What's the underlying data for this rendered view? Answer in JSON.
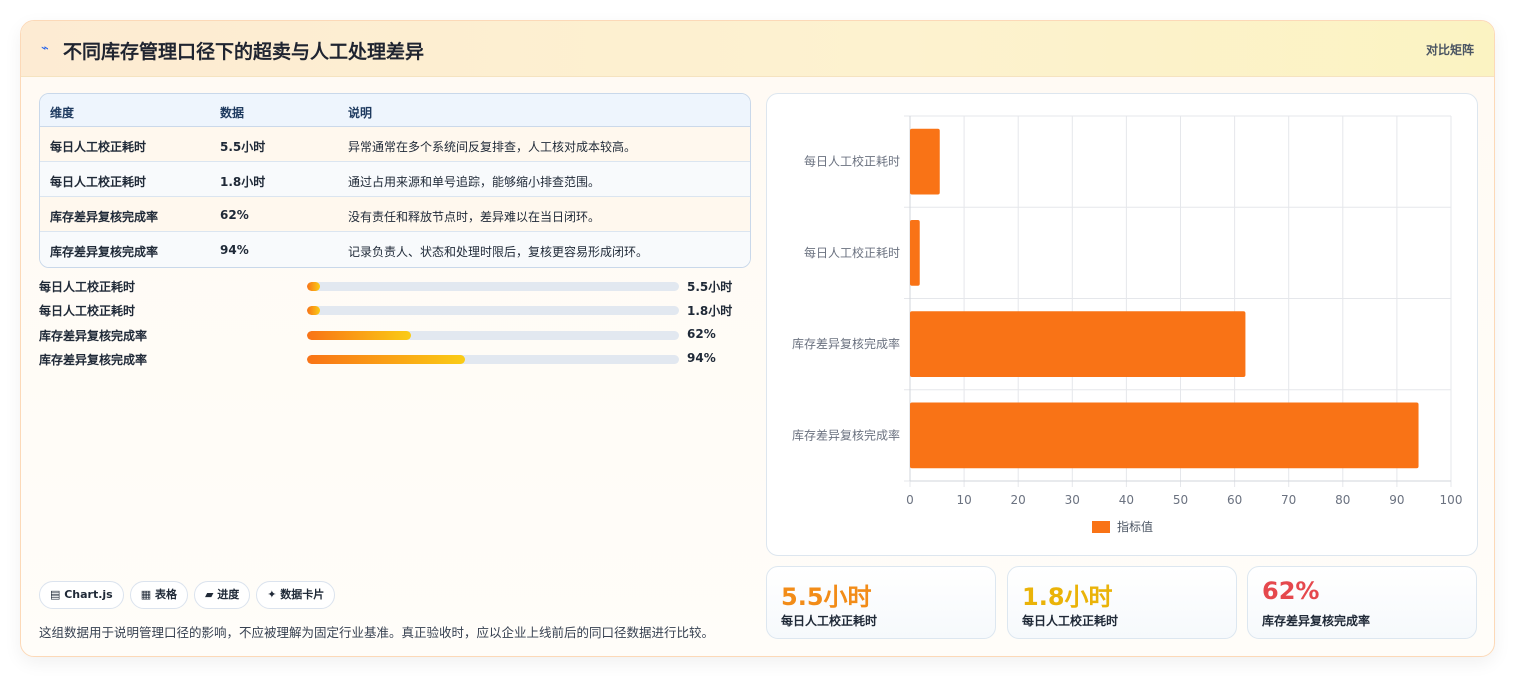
{
  "header": {
    "title": "不同库存管理口径下的超卖与人工处理差异",
    "tag": "对比矩阵"
  },
  "table": {
    "columns": [
      "维度",
      "数据",
      "说明"
    ],
    "rows": [
      {
        "dim": "每日人工校正耗时",
        "data": "5.5小时",
        "desc": "异常通常在多个系统间反复排查，人工核对成本较高。"
      },
      {
        "dim": "每日人工校正耗时",
        "data": "1.8小时",
        "desc": "通过占用来源和单号追踪，能够缩小排查范围。"
      },
      {
        "dim": "库存差异复核完成率",
        "data": "62%",
        "desc": "没有责任和释放节点时，差异难以在当日闭环。"
      },
      {
        "dim": "库存差异复核完成率",
        "data": "94%",
        "desc": "记录负责人、状态和处理时限后，复核更容易形成闭环。"
      }
    ]
  },
  "progress": [
    {
      "label": "每日人工校正耗时",
      "value": "5.5小时",
      "fraction": 0.034
    },
    {
      "label": "每日人工校正耗时",
      "value": "1.8小时",
      "fraction": 0.034
    },
    {
      "label": "库存差异复核完成率",
      "value": "62%",
      "fraction": 0.28
    },
    {
      "label": "库存差异复核完成率",
      "value": "94%",
      "fraction": 0.425
    }
  ],
  "chips": [
    "▤ Chart.js",
    "▦ 表格",
    "▰ 进度",
    "✦ 数据卡片"
  ],
  "note": "这组数据用于说明管理口径的影响，不应被理解为固定行业基准。真正验收时，应以企业上线前后的同口径数据进行比较。",
  "chart_data": {
    "type": "bar",
    "orientation": "horizontal",
    "categories": [
      "每日人工校正耗时",
      "每日人工校正耗时",
      "库存差异复核完成率",
      "库存差异复核完成率"
    ],
    "series": [
      {
        "name": "指标值",
        "values": [
          5.5,
          1.8,
          62,
          94
        ]
      }
    ],
    "xlim": [
      0,
      100
    ],
    "xticks": [
      0,
      10,
      20,
      30,
      40,
      50,
      60,
      70,
      80,
      90,
      100
    ],
    "grid": true,
    "legend": "bottom",
    "bar_color": "#f97316"
  },
  "kpis": [
    {
      "value": "5.5小时",
      "label": "每日人工校正耗时",
      "color": "#f28c18"
    },
    {
      "value": "1.8小时",
      "label": "每日人工校正耗时",
      "color": "#eab308"
    },
    {
      "value": "62%",
      "label": "库存差异复核完成率",
      "color": "#e5484d"
    }
  ]
}
